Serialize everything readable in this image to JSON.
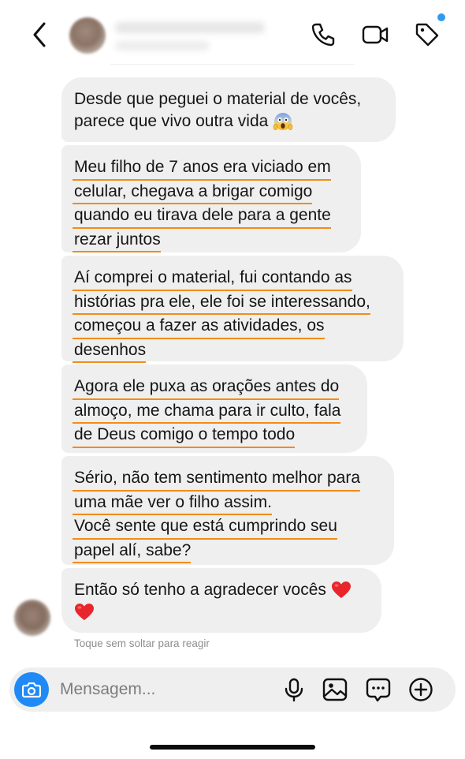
{
  "header": {
    "back_icon": "chevron-left-icon",
    "actions": [
      "phone-icon",
      "video-camera-icon",
      "tag-icon"
    ],
    "notification_dot_color": "#2f9bf0"
  },
  "messages": [
    {
      "lines": [
        "Desde que peguei o material de vocês,",
        "parece que vivo outra vida"
      ],
      "emoji": "screaming-face"
    },
    {
      "lines": [
        "Meu filho de 7 anos era viciado em",
        "celular, chegava a brigar comigo",
        "quando eu tirava dele para a gente",
        "rezar juntos"
      ]
    },
    {
      "lines": [
        "Aí comprei o material, fui contando as",
        "histórias pra ele, ele foi se interessando,",
        "começou a fazer as atividades, os",
        "desenhos"
      ]
    },
    {
      "lines": [
        "Agora ele puxa as orações antes do",
        "almoço, me chama para ir culto, fala",
        "de Deus comigo o tempo todo"
      ]
    },
    {
      "lines": [
        "Sério, não tem sentimento melhor para",
        "uma mãe ver o filho assim.",
        "Você sente que está cumprindo seu",
        "papel alí, sabe?"
      ]
    },
    {
      "lines": [
        "Então só tenho a agradecer vocês"
      ],
      "emoji": "red-heart"
    }
  ],
  "hint": "Toque sem soltar para reagir",
  "composer": {
    "placeholder": "Mensagem...",
    "icons": [
      "camera-icon",
      "microphone-icon",
      "gallery-icon",
      "sticker-icon",
      "plus-icon"
    ]
  },
  "colors": {
    "bubble": "#efefef",
    "underline": "#f28c16",
    "accent": "#1f8af5"
  }
}
